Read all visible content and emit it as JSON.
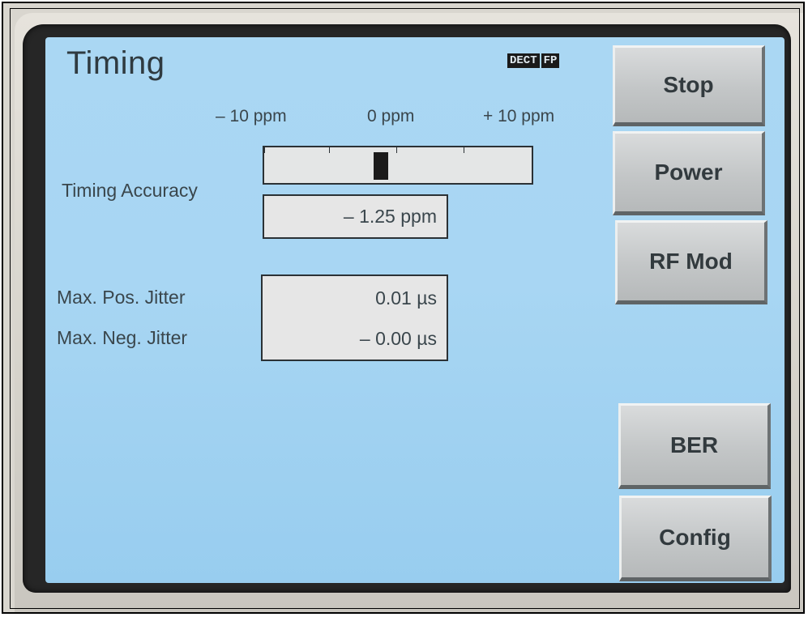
{
  "screen": {
    "title": "Timing",
    "badges": [
      "DECT",
      "FP"
    ]
  },
  "timing_accuracy": {
    "label": "Timing Accuracy",
    "scale_labels": [
      "– 10 ppm",
      "0 ppm",
      "+ 10 ppm"
    ],
    "scale_min_ppm": -10,
    "scale_max_ppm": 10,
    "indicator_ppm": -1.25,
    "value": "– 1.25 ppm"
  },
  "jitter": {
    "pos_label": "Max. Pos. Jitter",
    "pos_value": "0.01 µs",
    "neg_label": "Max. Neg. Jitter",
    "neg_value": "– 0.00 µs"
  },
  "softkeys": {
    "stop": "Stop",
    "power": "Power",
    "rf_mod": "RF Mod",
    "ber": "BER",
    "config": "Config"
  },
  "colors": {
    "screen_background": "#a8d6f3",
    "bezel": "#262626",
    "button_face": "#c3c6c7"
  }
}
